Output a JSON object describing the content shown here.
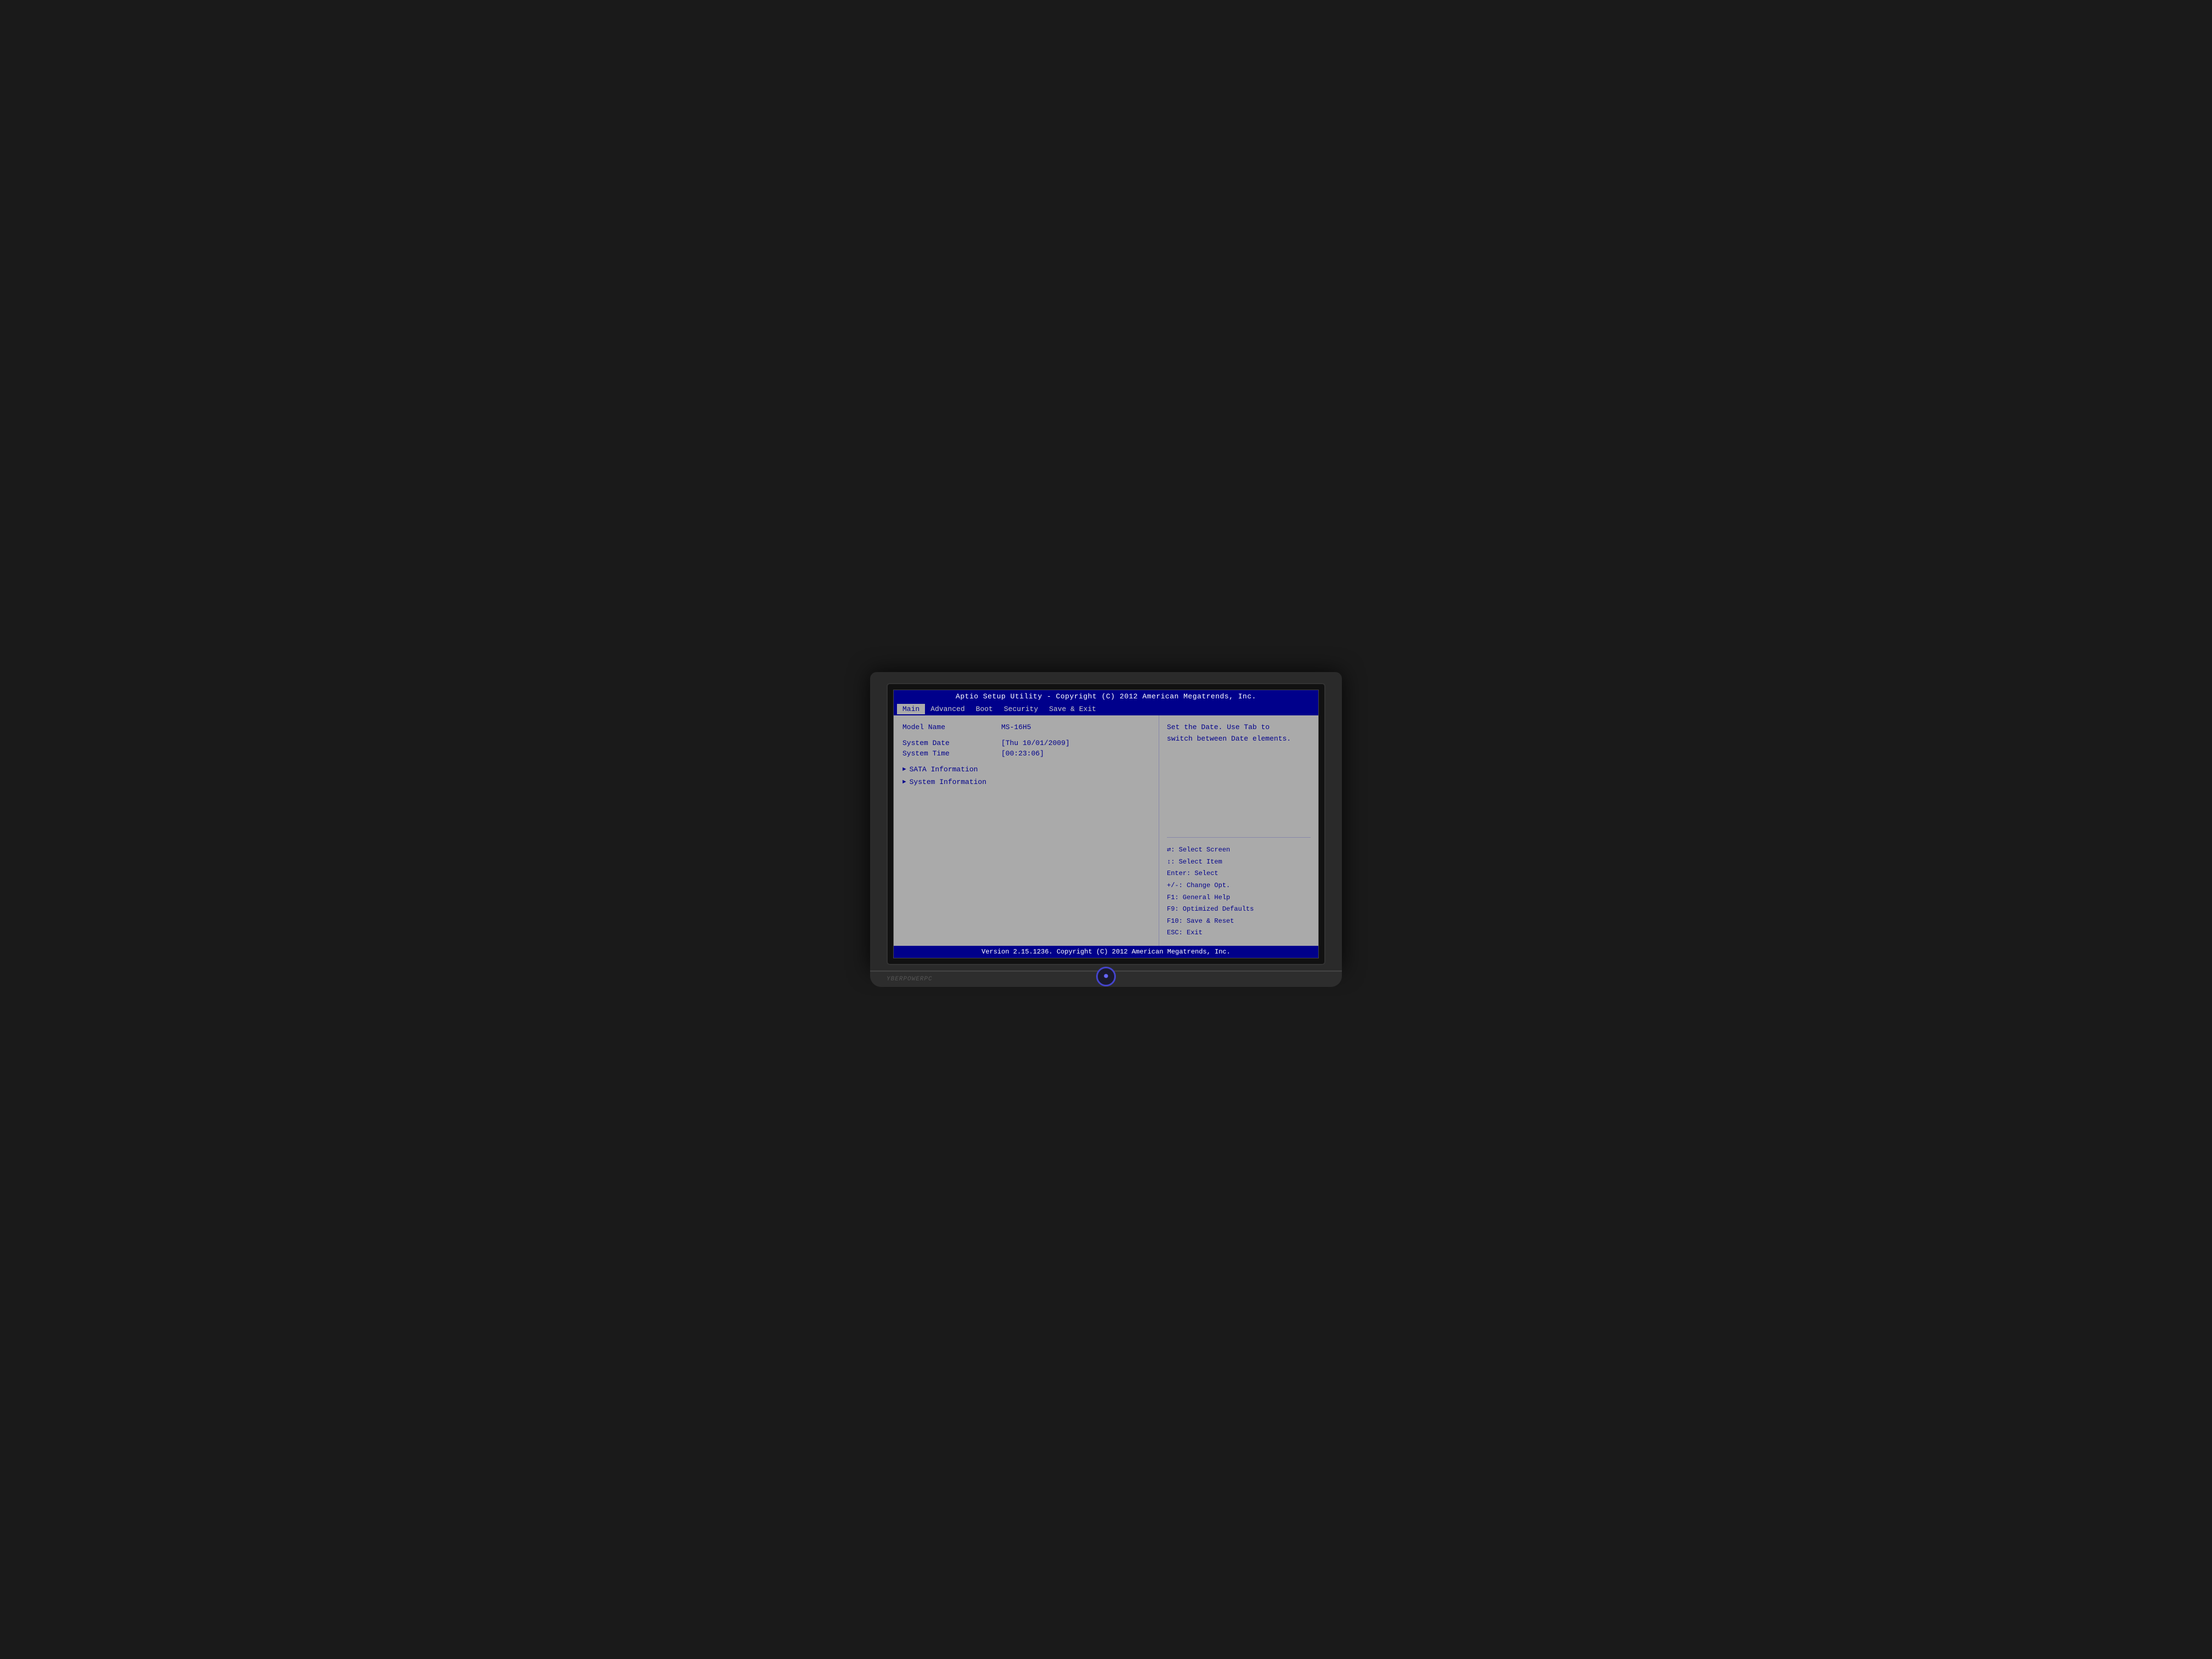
{
  "title_bar": {
    "text": "Aptio Setup Utility - Copyright (C) 2012 American Megatrends, Inc."
  },
  "menu": {
    "items": [
      {
        "label": "Main",
        "active": true
      },
      {
        "label": "Advanced",
        "active": false
      },
      {
        "label": "Boot",
        "active": false
      },
      {
        "label": "Security",
        "active": false
      },
      {
        "label": "Save & Exit",
        "active": false
      }
    ]
  },
  "fields": {
    "model_name_label": "Model Name",
    "model_name_value": "MS-16H5",
    "system_date_label": "System Date",
    "system_date_value": "[Thu 10/01/2009]",
    "system_time_label": "System Time",
    "system_time_value": "[00:23:06]"
  },
  "nav_items": [
    {
      "label": "SATA Information"
    },
    {
      "label": "System Information"
    }
  ],
  "help": {
    "description": "Set the Date. Use Tab to\nswitch between Date elements."
  },
  "shortcuts": [
    {
      "key": "→←:",
      "action": "Select Screen"
    },
    {
      "key": "↑↓:",
      "action": "Select Item"
    },
    {
      "key": "Enter:",
      "action": "Select"
    },
    {
      "key": "+/-:",
      "action": "Change Opt."
    },
    {
      "key": "F1:",
      "action": "General Help"
    },
    {
      "key": "F9:",
      "action": "Optimized Defaults"
    },
    {
      "key": "F10:",
      "action": "Save & Reset"
    },
    {
      "key": "ESC:",
      "action": "Exit"
    }
  ],
  "footer": {
    "text": "Version 2.15.1236. Copyright (C) 2012 American Megatrends, Inc."
  },
  "brand": {
    "text": "YBERPOWERPC"
  }
}
